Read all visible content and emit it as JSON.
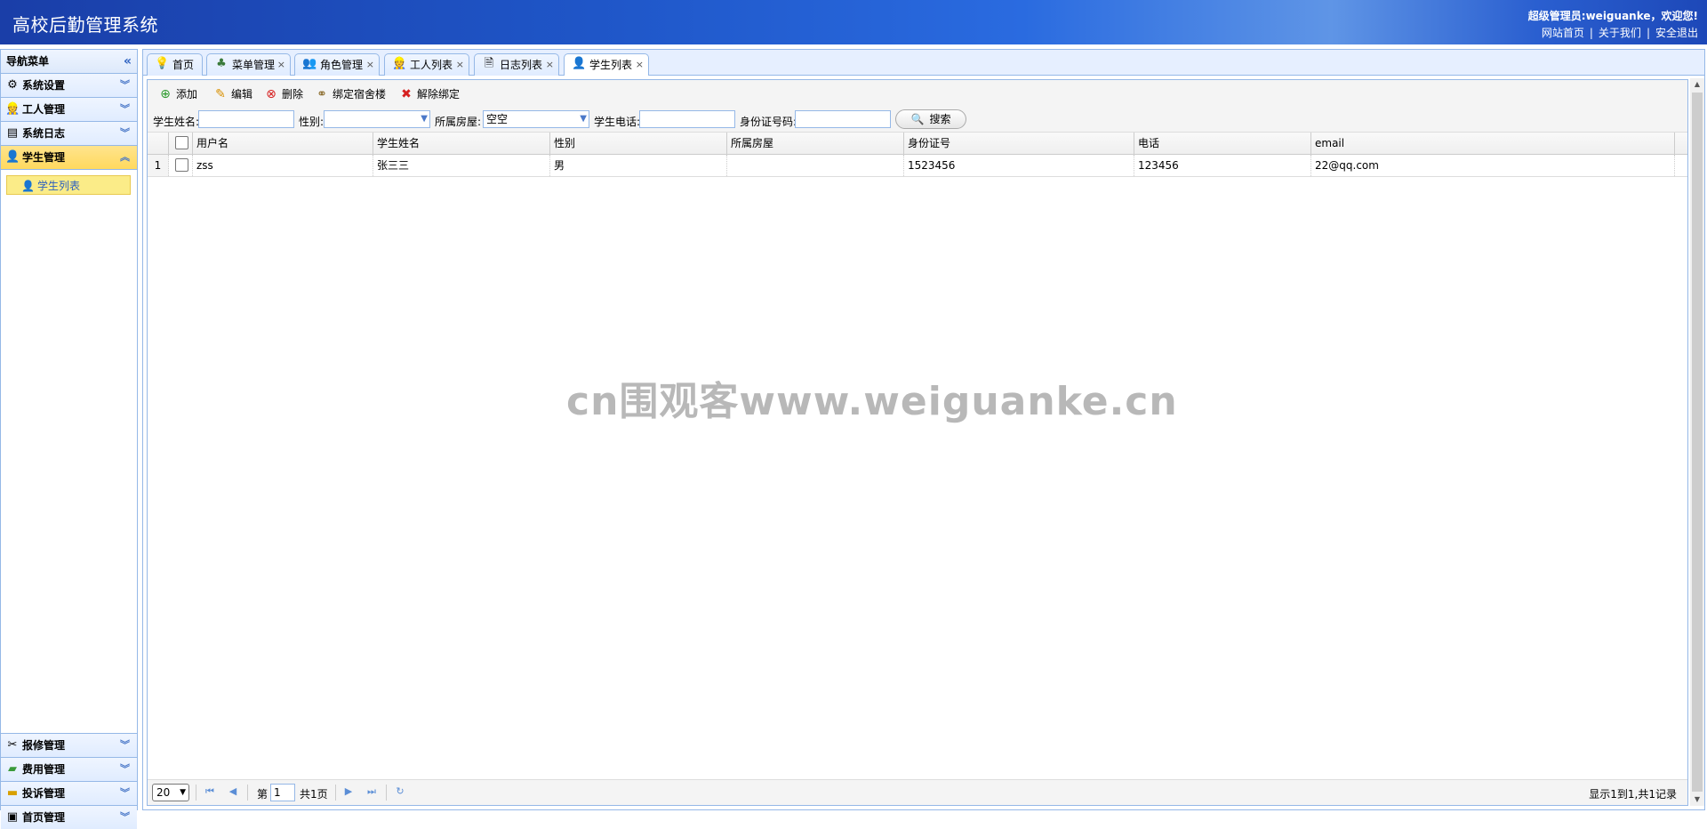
{
  "header": {
    "title": "高校后勤管理系统",
    "welcome_prefix": "超级管理员:",
    "username": "weiguanke",
    "welcome_suffix": "，欢迎您!",
    "links": [
      "网站首页",
      "关于我们",
      "安全退出"
    ],
    "separator": "|"
  },
  "sidebar": {
    "title": "导航菜单",
    "groups": [
      {
        "label": "系统设置",
        "icon": "gear-icon"
      },
      {
        "label": "工人管理",
        "icon": "worker-icon"
      },
      {
        "label": "系统日志",
        "icon": "log-icon"
      },
      {
        "label": "学生管理",
        "icon": "student-icon",
        "active": true
      }
    ],
    "active_sub_item": "学生列表",
    "bottom_groups": [
      {
        "label": "报修管理",
        "icon": "tools-icon"
      },
      {
        "label": "费用管理",
        "icon": "money-icon"
      },
      {
        "label": "投诉管理",
        "icon": "folder-icon"
      },
      {
        "label": "首页管理",
        "icon": "page-icon"
      }
    ]
  },
  "tabs": [
    {
      "label": "首页",
      "icon": "bulb-icon",
      "closable": false
    },
    {
      "label": "菜单管理",
      "icon": "sitemap-icon",
      "closable": true
    },
    {
      "label": "角色管理",
      "icon": "users-icon",
      "closable": true
    },
    {
      "label": "工人列表",
      "icon": "worker-icon",
      "closable": true
    },
    {
      "label": "日志列表",
      "icon": "doc-icon",
      "closable": true
    },
    {
      "label": "学生列表",
      "icon": "student-icon",
      "closable": true,
      "active": true
    }
  ],
  "toolbar": {
    "add": "添加",
    "edit": "编辑",
    "delete": "删除",
    "bind": "绑定宿舍楼",
    "unbind": "解除绑定"
  },
  "search": {
    "name_label": "学生姓名:",
    "name_value": "",
    "gender_label": "性别:",
    "gender_value": "",
    "room_label": "所属房屋:",
    "room_value": "空空",
    "phone_label": "学生电话:",
    "phone_value": "",
    "idcard_label": "身份证号码:",
    "idcard_value": "",
    "button": "搜索"
  },
  "table": {
    "columns": [
      "用户名",
      "学生姓名",
      "性别",
      "所属房屋",
      "身份证号",
      "电话",
      "email"
    ],
    "rows": [
      {
        "num": "1",
        "username": "zss",
        "name": "张三三",
        "gender": "男",
        "room": "",
        "idcard": "1523456",
        "phone": "123456",
        "email": "22@qq.com"
      }
    ]
  },
  "pager": {
    "page_size": "20",
    "page_prefix": "第",
    "page_value": "1",
    "page_suffix": "共1页",
    "info": "显示1到1,共1记录"
  },
  "watermark": "cn围观客www.weiguanke.cn",
  "colors": {
    "header": "#1f56c8",
    "border": "#95b8e7",
    "active_group": "#ffd95e",
    "active_sub_item": "#fbec88"
  }
}
